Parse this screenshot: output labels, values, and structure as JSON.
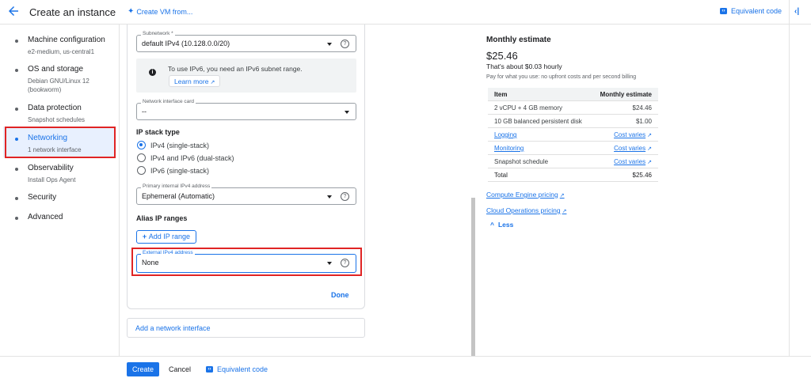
{
  "header": {
    "title": "Create an instance",
    "create_vm_from": "Create VM from...",
    "equivalent_code": "Equivalent code"
  },
  "nav": {
    "items": [
      {
        "label": "Machine configuration",
        "sub": "e2-medium, us-central1"
      },
      {
        "label": "OS and storage",
        "sub": "Debian GNU/Linux 12",
        "sub2": "(bookworm)"
      },
      {
        "label": "Data protection",
        "sub": "Snapshot schedules"
      },
      {
        "label": "Networking",
        "sub": "1 network interface"
      },
      {
        "label": "Observability",
        "sub": "Install Ops Agent"
      },
      {
        "label": "Security",
        "sub": ""
      },
      {
        "label": "Advanced",
        "sub": ""
      }
    ]
  },
  "form": {
    "subnetwork_label": "Subnetwork *",
    "subnetwork_value": "default IPv4 (10.128.0.0/20)",
    "ipv6_info": "To use IPv6, you need an IPv6 subnet range.",
    "learn_more": "Learn more",
    "nic_label": "Network interface card",
    "nic_value": "--",
    "ip_stack_title": "IP stack type",
    "ip_stack_options": [
      "IPv4 (single-stack)",
      "IPv4 and IPv6 (dual-stack)",
      "IPv6 (single-stack)"
    ],
    "ip_stack_selected": "IPv4 (single-stack)",
    "primary_ip_label": "Primary internal IPv4 address",
    "primary_ip_value": "Ephemeral (Automatic)",
    "alias_title": "Alias IP ranges",
    "add_ip_range": "Add IP range",
    "external_ip_label": "External IPv4 address",
    "external_ip_value": "None",
    "done": "Done",
    "add_network_interface": "Add a network interface"
  },
  "estimate": {
    "title": "Monthly estimate",
    "amount": "$25.46",
    "hourly": "That's about $0.03 hourly",
    "note": "Pay for what you use: no upfront costs and per second billing",
    "col_item": "Item",
    "col_estimate": "Monthly estimate",
    "rows": [
      {
        "item": "2 vCPU + 4 GB memory",
        "value": "$24.46"
      },
      {
        "item": "10 GB balanced persistent disk",
        "value": "$1.00"
      },
      {
        "item": "Logging",
        "value": "Cost varies"
      },
      {
        "item": "Monitoring",
        "value": "Cost varies"
      },
      {
        "item": "Snapshot schedule",
        "value": "Cost varies"
      },
      {
        "item": "Total",
        "value": "$25.46"
      }
    ],
    "compute_pricing": "Compute Engine pricing",
    "ops_pricing": "Cloud Operations pricing",
    "less": "Less"
  },
  "footer": {
    "create": "Create",
    "cancel": "Cancel",
    "equivalent_code": "Equivalent code"
  },
  "colors": {
    "accent": "#1a73e8",
    "highlight_box": "#e02424",
    "active_nav_bg": "#e8f0fe"
  }
}
